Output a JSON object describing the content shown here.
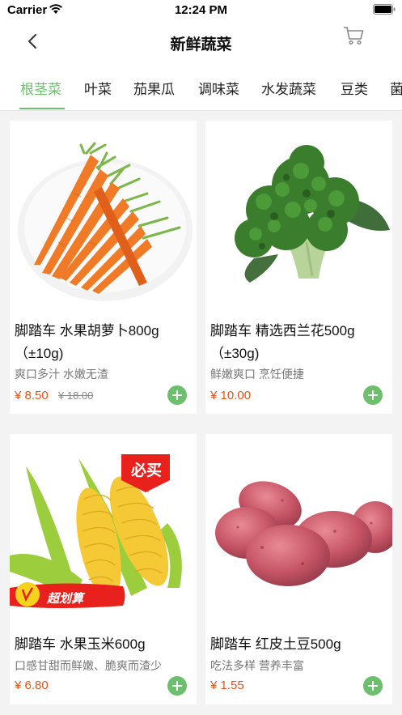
{
  "status_bar": {
    "carrier": "Carrier",
    "time": "12:24 PM"
  },
  "nav": {
    "title": "新鲜蔬菜",
    "back_icon": "chevron-left-icon",
    "cart_icon": "cart-icon"
  },
  "tabs": [
    {
      "label": "根茎菜",
      "active": true
    },
    {
      "label": "叶菜",
      "active": false
    },
    {
      "label": "茄果瓜",
      "active": false
    },
    {
      "label": "调味菜",
      "active": false
    },
    {
      "label": "水发蔬菜",
      "active": false
    },
    {
      "label": "豆类",
      "active": false
    },
    {
      "label": "菌",
      "active": false
    }
  ],
  "products": [
    {
      "name": "脚踏车 水果胡萝卜800g（±10g)",
      "desc": "爽口多汁 水嫩无渣",
      "price": "¥ 8.50",
      "old_price": "¥ 18.00",
      "image": "carrots"
    },
    {
      "name": "脚踏车 精选西兰花500g（±30g)",
      "desc": "鲜嫩爽口 烹饪便捷",
      "price": "¥ 10.00",
      "image": "broccoli"
    },
    {
      "name": "脚踏车 水果玉米600g",
      "desc": "口感甘甜而鲜嫩、脆爽而渣少",
      "price": "¥ 6.80",
      "image": "corn",
      "badge_top": "必买",
      "badge_bottom": "超划算"
    },
    {
      "name": "脚踏车 红皮土豆500g",
      "desc": "吃法多样 营养丰富",
      "price": "¥ 1.55",
      "image": "potatoes"
    }
  ],
  "colors": {
    "accent": "#6cbf6c",
    "price": "#e5531a",
    "badge_red": "#e8211d"
  }
}
